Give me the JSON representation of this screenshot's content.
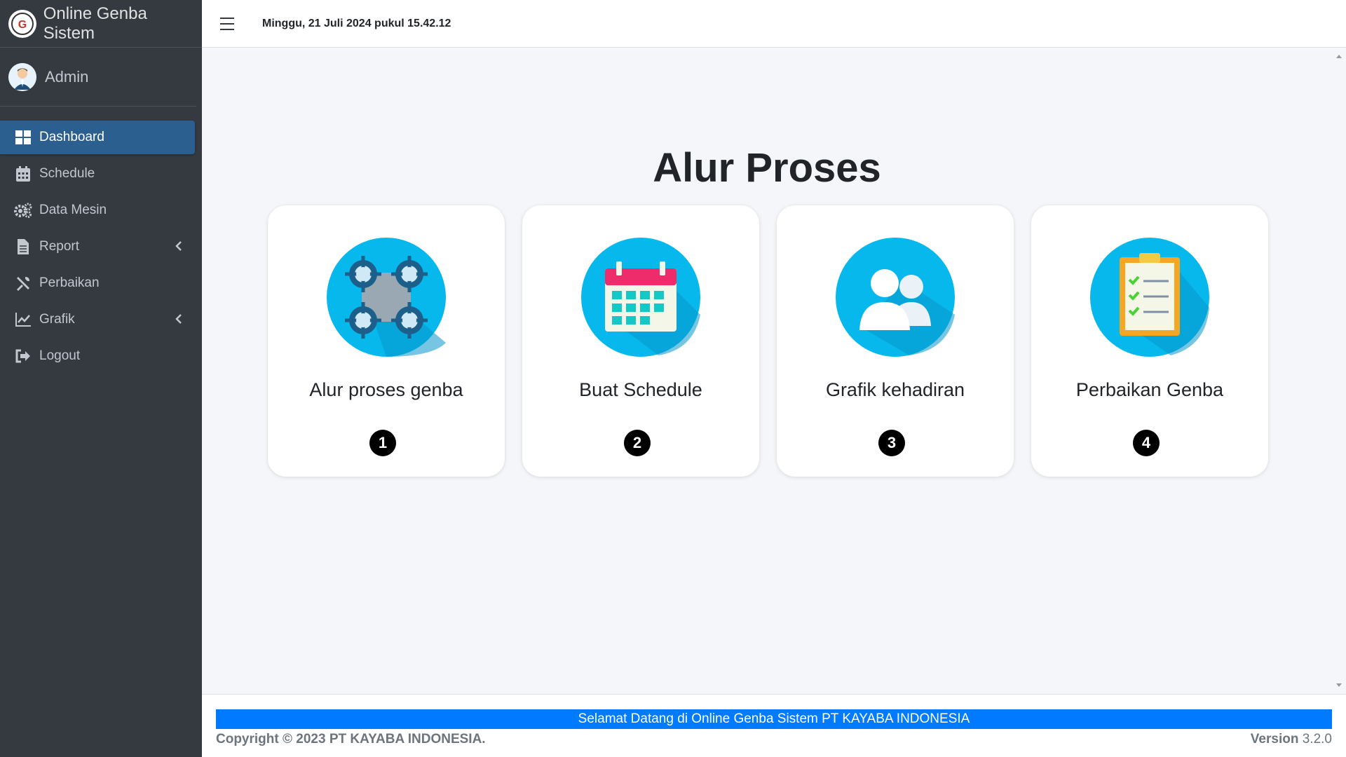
{
  "brand": {
    "title": "Online Genba Sistem"
  },
  "user": {
    "name": "Admin"
  },
  "sidebar": {
    "items": [
      {
        "label": "Dashboard",
        "icon": "dashboard-icon",
        "active": true
      },
      {
        "label": "Schedule",
        "icon": "calendar-icon"
      },
      {
        "label": "Data Mesin",
        "icon": "cogs-icon"
      },
      {
        "label": "Report",
        "icon": "document-icon",
        "chevron": true
      },
      {
        "label": "Perbaikan",
        "icon": "tools-icon"
      },
      {
        "label": "Grafik",
        "icon": "chart-line-icon",
        "chevron": true
      },
      {
        "label": "Logout",
        "icon": "logout-icon"
      }
    ]
  },
  "header": {
    "datetime": "Minggu, 21 Juli 2024 pukul 15.42.12"
  },
  "main": {
    "title": "Alur Proses",
    "cards": [
      {
        "label": "Alur proses genba",
        "number": "1",
        "icon": "process-gears-icon"
      },
      {
        "label": "Buat Schedule",
        "number": "2",
        "icon": "calendar-icon"
      },
      {
        "label": "Grafik kehadiran",
        "number": "3",
        "icon": "users-icon"
      },
      {
        "label": "Perbaikan Genba",
        "number": "4",
        "icon": "clipboard-checklist-icon"
      }
    ]
  },
  "footer": {
    "marquee": "Selamat Datang di Online Genba Sistem PT KAYABA INDONESIA",
    "copyright": "Copyright © 2023 PT KAYABA INDONESIA.",
    "version_label": "Version",
    "version_number": "3.2.0"
  },
  "colors": {
    "sidebar_bg": "#343a40",
    "active_item": "#2b5f8f",
    "accent": "#007bff",
    "icon_circle": "#07b8ec"
  }
}
